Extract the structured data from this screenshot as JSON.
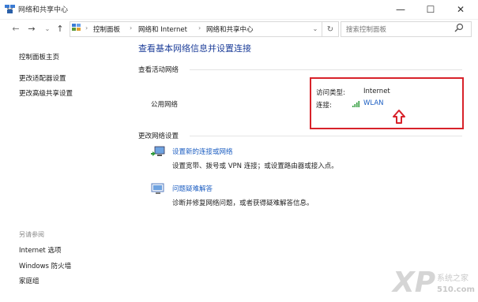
{
  "window": {
    "title": "网络和共享中心",
    "controls": {
      "minimize": "—",
      "maximize": "☐",
      "close": "✕"
    }
  },
  "address": {
    "crumbs": [
      "控制面板",
      "网络和 Internet",
      "网络和共享中心"
    ],
    "search_placeholder": "搜索控制面板"
  },
  "sidebar": {
    "items": [
      "控制面板主页",
      "更改适配器设置",
      "更改高级共享设置"
    ],
    "see_also_label": "另请参阅",
    "see_also_items": [
      "Internet 选项",
      "Windows 防火墙",
      "家庭组"
    ]
  },
  "main": {
    "title": "查看基本网络信息并设置连接",
    "active_networks_label": "查看活动网络",
    "network_name": "公用网络",
    "access_type_label": "访问类型:",
    "access_type_value": "Internet",
    "connections_label": "连接:",
    "connection_value": "WLAN",
    "change_settings_label": "更改网络设置",
    "tasks": [
      {
        "link": "设置新的连接或网络",
        "desc": "设置宽带、拨号或 VPN 连接；或设置路由器或接入点。"
      },
      {
        "link": "问题疑难解答",
        "desc": "诊断并修复网络问题，或者获得疑难解答信息。"
      }
    ]
  },
  "watermark": {
    "logo": "XP",
    "text": "系统之家",
    "site": "510.com"
  },
  "colors": {
    "highlight_box": "#d8222a",
    "link": "#1c5ec2",
    "title": "#1e3f9a"
  }
}
